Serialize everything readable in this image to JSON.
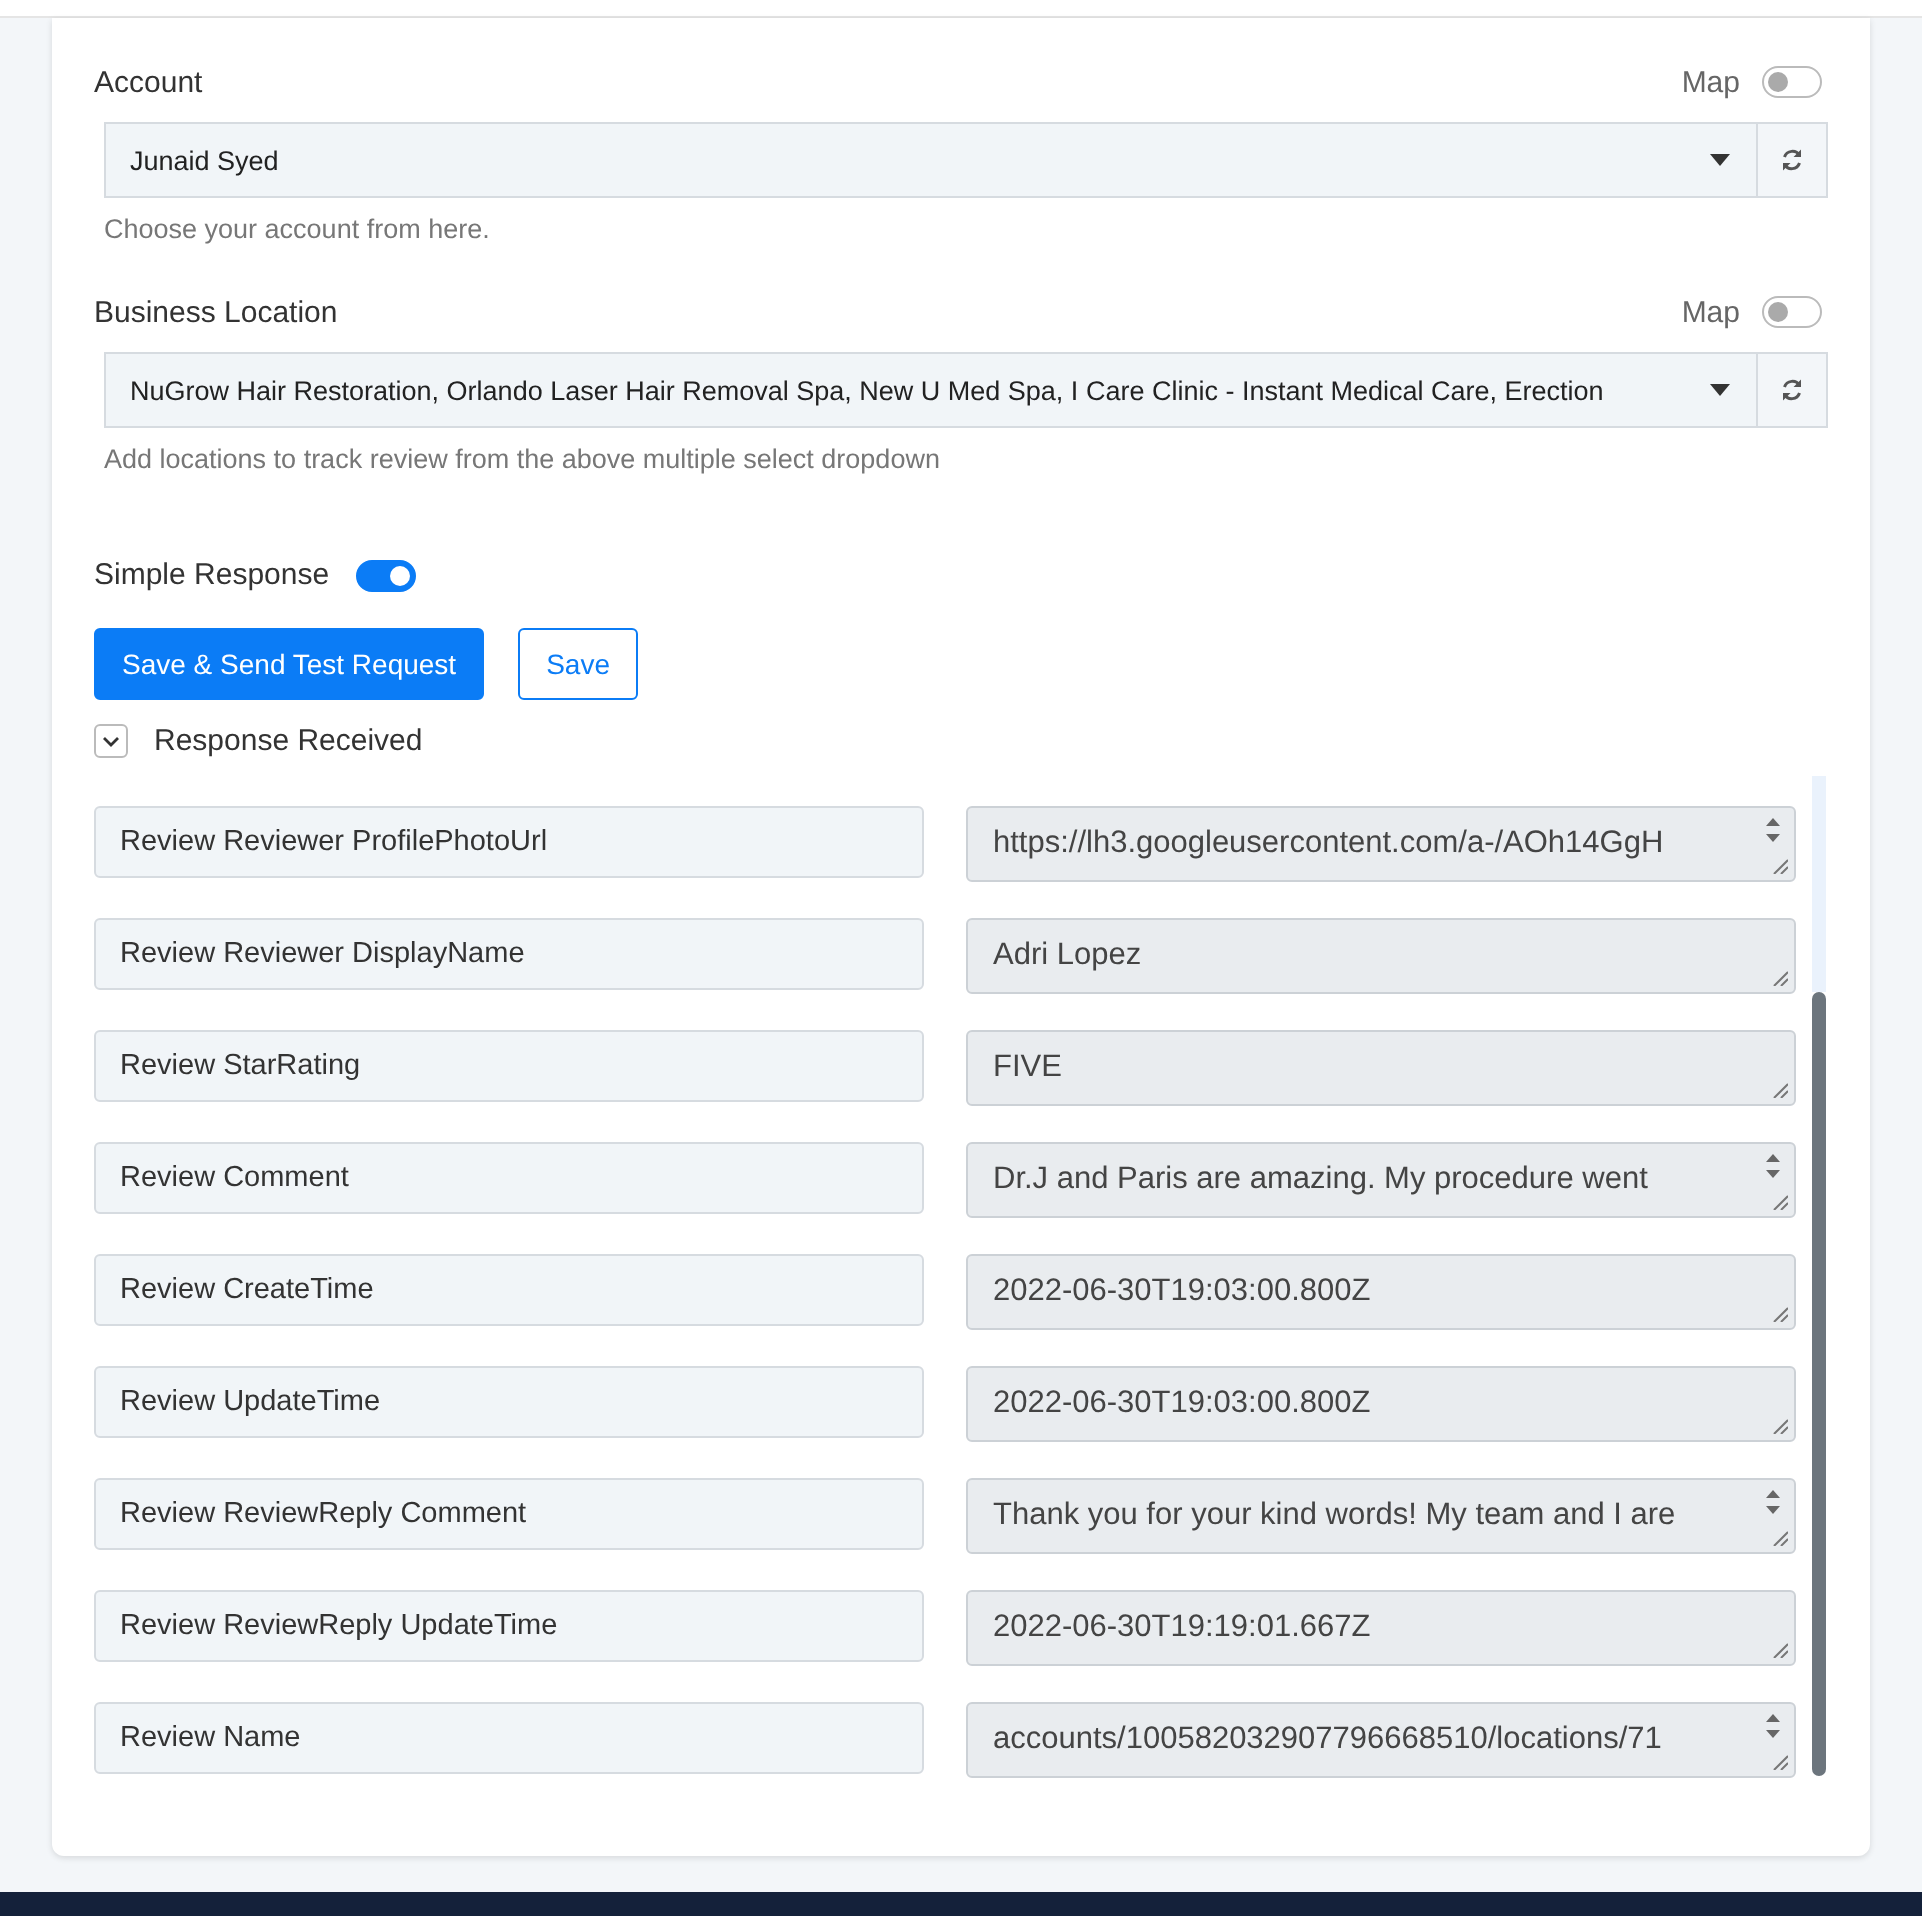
{
  "account": {
    "label": "Account",
    "map_label": "Map",
    "map_on": false,
    "value": "Junaid Syed",
    "help": "Choose your account from here."
  },
  "business_location": {
    "label": "Business Location",
    "map_label": "Map",
    "map_on": false,
    "value": "NuGrow Hair Restoration, Orlando Laser Hair Removal Spa, New U Med Spa, I Care Clinic - Instant Medical Care, Erection",
    "help": "Add locations to track review from the above multiple select dropdown"
  },
  "simple_response": {
    "label": "Simple Response",
    "on": true
  },
  "buttons": [
    {
      "label": "Save & Send Test Request",
      "kind": "primary"
    },
    {
      "label": "Save",
      "kind": "outline"
    }
  ],
  "response": {
    "label": "Response Received",
    "expanded": true,
    "rows": [
      {
        "key": "Review Reviewer ProfilePhotoUrl",
        "value": "https://lh3.googleusercontent.com/a-/AOh14GgH",
        "scrollable": true
      },
      {
        "key": "Review Reviewer DisplayName",
        "value": "Adri Lopez",
        "scrollable": false
      },
      {
        "key": "Review StarRating",
        "value": "FIVE",
        "scrollable": false
      },
      {
        "key": "Review Comment",
        "value": "Dr.J and Paris are amazing. My procedure went",
        "scrollable": true
      },
      {
        "key": "Review CreateTime",
        "value": "2022-06-30T19:03:00.800Z",
        "scrollable": false
      },
      {
        "key": "Review UpdateTime",
        "value": "2022-06-30T19:03:00.800Z",
        "scrollable": false
      },
      {
        "key": "Review ReviewReply Comment",
        "value": "Thank you for your kind words! My team and I are",
        "scrollable": true
      },
      {
        "key": "Review ReviewReply UpdateTime",
        "value": "2022-06-30T19:19:01.667Z",
        "scrollable": false
      },
      {
        "key": "Review Name",
        "value": "accounts/100582032907796668510/locations/71",
        "scrollable": true
      }
    ]
  }
}
